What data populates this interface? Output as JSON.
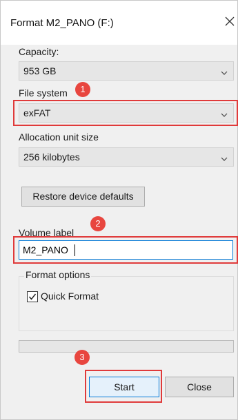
{
  "window": {
    "title": "Format M2_PANO (F:)",
    "close_icon": "close-icon"
  },
  "capacity": {
    "label": "Capacity:",
    "value": "953 GB"
  },
  "file_system": {
    "label": "File system",
    "value": "exFAT"
  },
  "allocation_unit": {
    "label": "Allocation unit size",
    "value": "256 kilobytes"
  },
  "restore_button": {
    "label": "Restore device defaults"
  },
  "volume_label": {
    "label": "Volume label",
    "value": "M2_PANO"
  },
  "format_options": {
    "legend": "Format options",
    "quick_format_label": "Quick Format",
    "quick_format_checked": true
  },
  "progress": {
    "value": 0
  },
  "buttons": {
    "start": "Start",
    "close": "Close"
  },
  "annotations": {
    "badge_1": "1",
    "badge_2": "2",
    "badge_3": "3",
    "color": "#e03a3a"
  }
}
